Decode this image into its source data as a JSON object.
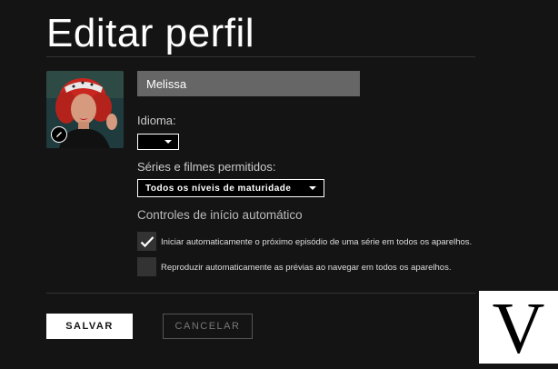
{
  "header": {
    "title": "Editar perfil"
  },
  "profile": {
    "name_value": "Melissa",
    "avatar_alt": "Profile avatar",
    "edit_icon": "pencil-icon"
  },
  "language": {
    "label": "Idioma:",
    "selected": ""
  },
  "maturity": {
    "label": "Séries e filmes permitidos:",
    "selected": "Todos os níveis de maturidade"
  },
  "autoplay": {
    "heading": "Controles de início automático",
    "options": [
      {
        "label": "Iniciar automaticamente o próximo episódio de uma série em todos os aparelhos.",
        "checked": true
      },
      {
        "label": "Reproduzir automaticamente as prévias ao navegar em todos os aparelhos.",
        "checked": false
      }
    ]
  },
  "actions": {
    "save_label": "SALVAR",
    "cancel_label": "CANCELAR"
  },
  "watermark": {
    "letter": "V"
  },
  "colors": {
    "background": "#141414",
    "input_bg": "#666666",
    "checkbox_bg": "#333333",
    "save_bg": "#ffffff"
  }
}
